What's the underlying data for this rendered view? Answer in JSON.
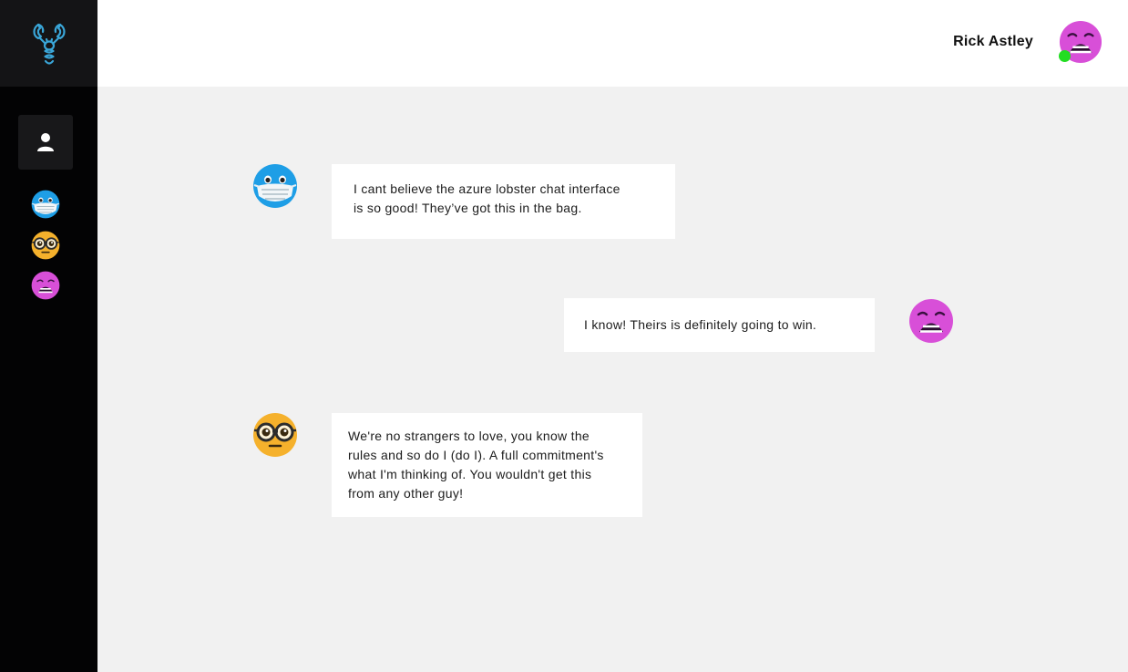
{
  "header": {
    "user_name": "Rick Astley",
    "status": "online"
  },
  "sidebar": {
    "logo": "lobster-logo-icon",
    "profile_icon": "user-icon",
    "contacts": [
      {
        "avatar": "face-with-mask-emoji"
      },
      {
        "avatar": "nerd-face-emoji"
      },
      {
        "avatar": "anguished-face-emoji"
      }
    ]
  },
  "messages": [
    {
      "side": "left",
      "avatar": "face-with-mask-emoji",
      "text": "I cant believe the azure lobster chat interface\nis so good! They’ve got this in the bag."
    },
    {
      "side": "right",
      "avatar": "anguished-face-emoji",
      "text": "I know! Theirs is definitely going to win."
    },
    {
      "side": "left",
      "avatar": "nerd-face-emoji",
      "text": "We're no strangers to love, you know the\nrules and so do I (do I). A full commitment's\nwhat I'm thinking of. You wouldn't get this\nfrom any other guy!"
    }
  ],
  "colors": {
    "sidebar_bg": "#030304",
    "logo_bg": "#141416",
    "accent": "#3aa6d8",
    "chat_bg": "#f1f1f1",
    "status_online": "#22dd22"
  }
}
